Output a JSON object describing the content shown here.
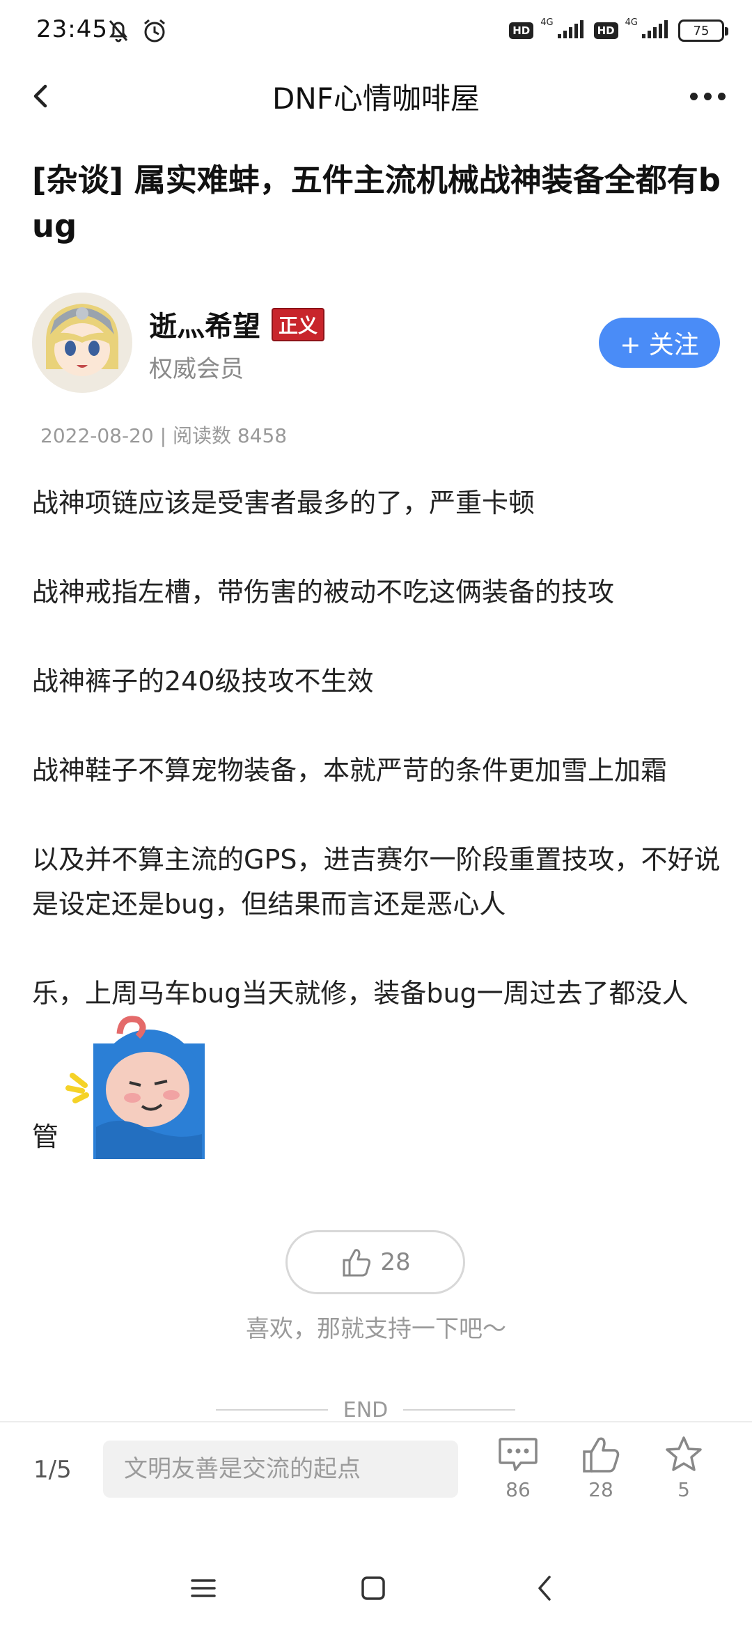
{
  "status_bar": {
    "time": "23:45",
    "network_1": "HD",
    "network_1_type": "4G",
    "network_2": "HD",
    "network_2_type": "4G",
    "battery": "75",
    "icons": [
      "mute-bell-icon",
      "alarm-icon",
      "signal-icon",
      "battery-icon"
    ]
  },
  "nav": {
    "title": "DNF心情咖啡屋",
    "back_icon": "chevron-left-icon",
    "more_icon": "more-dots-icon"
  },
  "article": {
    "title": "[杂谈] 属实难蚌，五件主流机械战神装备全都有bug",
    "author": {
      "name": "逝灬希望",
      "badge": "正义",
      "role": "权威会员",
      "follow_label": "+ 关注"
    },
    "meta": "2022-08-20 | 阅读数 8458",
    "paragraphs": [
      "战神项链应该是受害者最多的了，严重卡顿",
      "战神戒指左槽，带伤害的被动不吃这俩装备的技攻",
      "战神裤子的240级技攻不生效",
      "战神鞋子不算宠物装备，本就严苛的条件更加雪上加霜",
      "以及并不算主流的GPS，进吉赛尔一阶段重置技攻，不好说是设定还是bug，但结果而言还是恶心人",
      "乐，上周马车bug当天就修，装备bug一周过去了都没人"
    ],
    "last_word": "管"
  },
  "like": {
    "count": "28",
    "hint": "喜欢，那就支持一下吧～",
    "end_label": "END"
  },
  "bottom_bar": {
    "page": "1/5",
    "comment_placeholder": "文明友善是交流的起点",
    "comments": "86",
    "likes": "28",
    "favorites": "5"
  },
  "colors": {
    "accent": "#4a8cf7",
    "badge": "#c8252c"
  }
}
